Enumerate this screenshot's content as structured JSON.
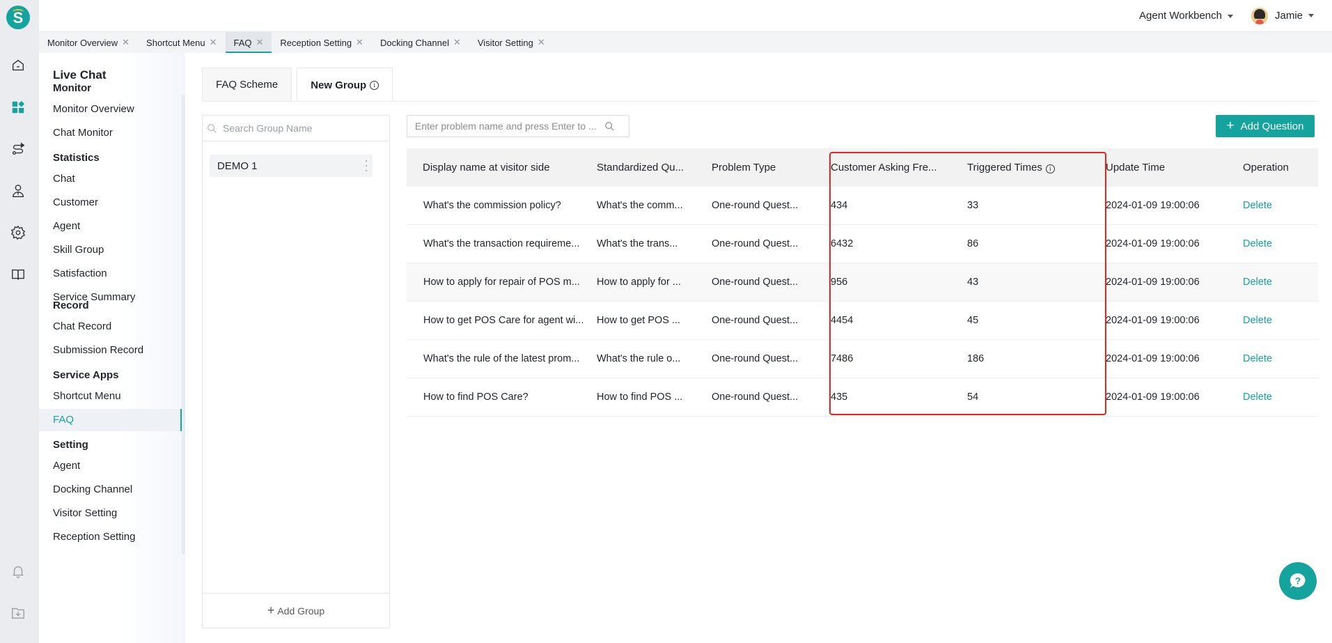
{
  "brand": {
    "logo_letter": "S",
    "accent": "#14a39d"
  },
  "header": {
    "workbench_label": "Agent Workbench",
    "user_name": "Jamie"
  },
  "rail_icons": [
    "home-icon",
    "apps-icon",
    "route-icon",
    "agent-icon",
    "settings-icon",
    "book-icon",
    "bell-icon",
    "download-folder-icon"
  ],
  "page_tabs": [
    {
      "label": "Monitor Overview",
      "active": false
    },
    {
      "label": "Shortcut Menu",
      "active": false
    },
    {
      "label": "FAQ",
      "active": true
    },
    {
      "label": "Reception Setting",
      "active": false
    },
    {
      "label": "Docking Channel",
      "active": false
    },
    {
      "label": "Visitor Setting",
      "active": false
    }
  ],
  "nav": {
    "title": "Live Chat",
    "sections": [
      {
        "title": "Monitor",
        "items": [
          "Monitor Overview",
          "Chat Monitor"
        ]
      },
      {
        "title": "Statistics",
        "items": [
          "Chat",
          "Customer",
          "Agent",
          "Skill Group",
          "Satisfaction",
          "Service Summary"
        ]
      },
      {
        "title": "Record",
        "items": [
          "Chat Record",
          "Submission Record"
        ]
      },
      {
        "title": "Service Apps",
        "items": [
          "Shortcut Menu",
          "FAQ"
        ]
      },
      {
        "title": "Setting",
        "items": [
          "Agent",
          "Docking Channel",
          "Visitor Setting",
          "Reception Setting"
        ]
      }
    ],
    "active_item": "FAQ"
  },
  "faq_tabs": [
    {
      "label": "FAQ Scheme",
      "active": false
    },
    {
      "label": "New Group",
      "active": true,
      "has_info": true
    }
  ],
  "groups": {
    "search_placeholder": "Search Group Name",
    "items": [
      "DEMO 1"
    ],
    "add_label": "Add Group"
  },
  "questions": {
    "search_placeholder": "Enter problem name and press Enter to ...",
    "add_label": "Add Question",
    "columns": [
      "Display name at visitor side",
      "Standardized Qu...",
      "Problem Type",
      "Customer Asking Fre...",
      "Triggered Times",
      "Update Time",
      "Operation"
    ],
    "rows": [
      {
        "display": "What's the commission policy?",
        "standard": "What's the comm...",
        "type": "One-round Quest...",
        "freq": "434",
        "triggered": "33",
        "updated": "2024-01-09 19:00:06",
        "op": "Delete"
      },
      {
        "display": "What's the transaction requireme...",
        "standard": "What's the trans...",
        "type": "One-round Quest...",
        "freq": "6432",
        "triggered": "86",
        "updated": "2024-01-09 19:00:06",
        "op": "Delete"
      },
      {
        "display": "How to apply for repair of POS m...",
        "standard": "How to apply for ...",
        "type": "One-round Quest...",
        "freq": "956",
        "triggered": "43",
        "updated": "2024-01-09 19:00:06",
        "op": "Delete"
      },
      {
        "display": "How to get POS Care for agent wi...",
        "standard": "How to get POS ...",
        "type": "One-round Quest...",
        "freq": "4454",
        "triggered": "45",
        "updated": "2024-01-09 19:00:06",
        "op": "Delete"
      },
      {
        "display": "What's the rule of the latest prom...",
        "standard": "What's the rule o...",
        "type": "One-round Quest...",
        "freq": "7486",
        "triggered": "186",
        "updated": "2024-01-09 19:00:06",
        "op": "Delete"
      },
      {
        "display": "How to find POS Care?",
        "standard": "How to find POS ...",
        "type": "One-round Quest...",
        "freq": "435",
        "triggered": "54",
        "updated": "2024-01-09 19:00:06",
        "op": "Delete"
      }
    ],
    "hovered_row": 2
  },
  "help_button": {
    "icon": "help-chat-icon"
  }
}
